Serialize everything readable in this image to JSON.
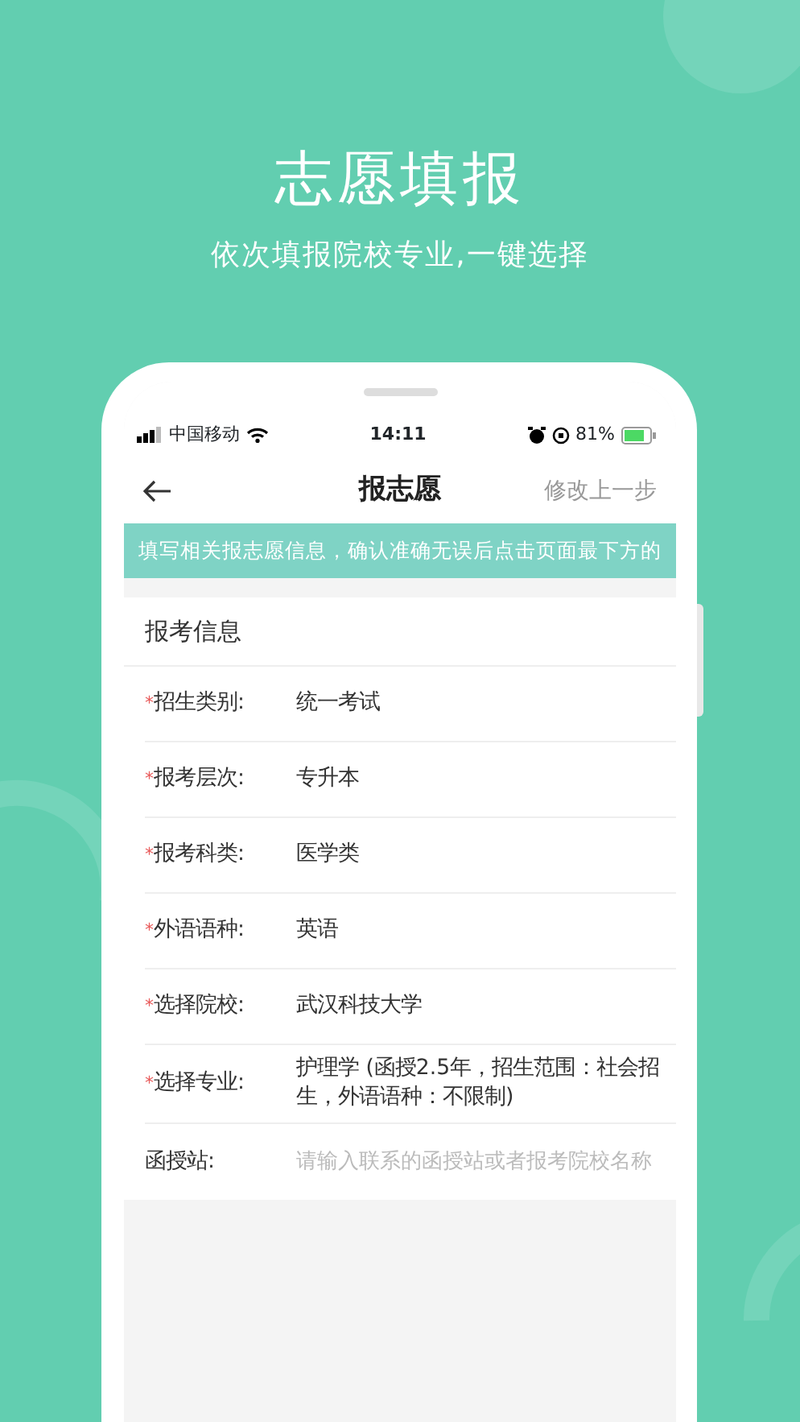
{
  "headline": "志愿填报",
  "subtitle": "依次填报院校专业,一键选择",
  "status_bar": {
    "carrier": "中国移动",
    "time": "14:11",
    "battery": "81%"
  },
  "nav": {
    "title": "报志愿",
    "action": "修改上一步"
  },
  "notice": "填写相关报志愿信息，确认准确无误后点击页面最下方的",
  "section_title": "报考信息",
  "fields": [
    {
      "label": "招生类别:",
      "required_mark": "*",
      "value": "统一考试"
    },
    {
      "label": "报考层次:",
      "required_mark": "*",
      "value": "专升本"
    },
    {
      "label": "报考科类:",
      "required_mark": "*",
      "value": "医学类"
    },
    {
      "label": "外语语种:",
      "required_mark": "*",
      "value": "英语"
    },
    {
      "label": "选择院校:",
      "required_mark": "*",
      "value": "武汉科技大学"
    },
    {
      "label": "选择专业:",
      "required_mark": "*",
      "value": "护理学 (函授2.5年，招生范围：社会招生，外语语种：不限制)"
    },
    {
      "label": "函授站:",
      "placeholder": "请输入联系的函授站或者报考院校名称"
    }
  ]
}
